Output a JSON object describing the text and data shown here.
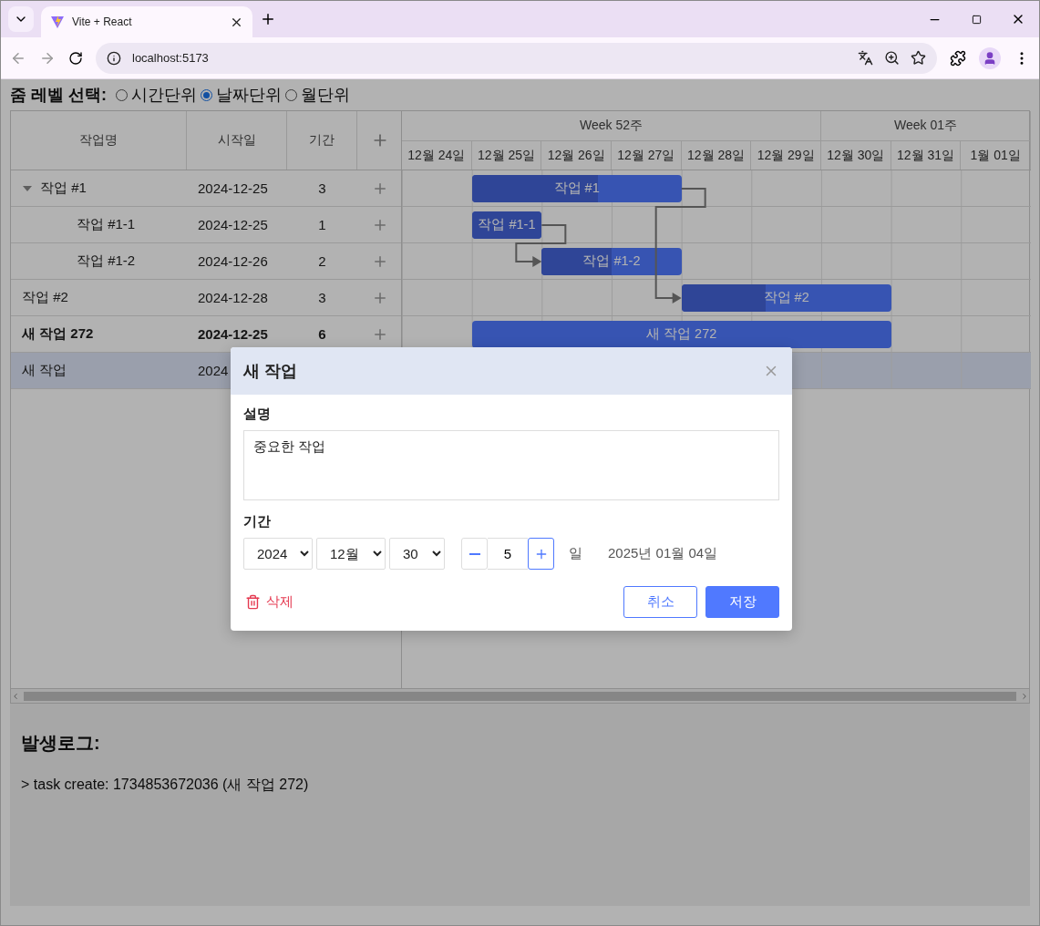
{
  "browser": {
    "tab_title": "Vite + React",
    "url": "localhost:5173"
  },
  "zoom": {
    "label": "줌 레벨 선택:",
    "options": [
      {
        "label": "시간단위",
        "selected": false
      },
      {
        "label": "날짜단위",
        "selected": true
      },
      {
        "label": "월단위",
        "selected": false
      }
    ]
  },
  "gantt": {
    "columns": [
      "작업명",
      "시작일",
      "기간"
    ],
    "weeks": [
      {
        "label": "Week 52주",
        "days": [
          "12월 24일",
          "12월 25일",
          "12월 26일",
          "12월 27일",
          "12월 28일",
          "12월 29일"
        ]
      },
      {
        "label": "Week 01주",
        "days": [
          "12월 30일",
          "12월 31일",
          "1월 01일"
        ]
      }
    ],
    "tasks": [
      {
        "name": "작업 #1",
        "start": "2024-12-25",
        "duration": "3",
        "bold": false,
        "selected": false,
        "expanded": true,
        "bar": {
          "label": "작업 #1",
          "level": 0.6
        },
        "children": [
          {
            "name": "작업 #1-1",
            "start": "2024-12-25",
            "duration": "1",
            "bold": false,
            "selected": false,
            "bar": {
              "label": "작업 #1-1",
              "level": 1
            }
          },
          {
            "name": "작업 #1-2",
            "start": "2024-12-26",
            "duration": "2",
            "bold": false,
            "selected": false,
            "bar": {
              "label": "작업 #1-2",
              "level": 0.5
            }
          }
        ]
      },
      {
        "name": "작업 #2",
        "start": "2024-12-28",
        "duration": "3",
        "bold": false,
        "selected": false,
        "bar": {
          "label": "작업 #2",
          "level": 0.4
        }
      },
      {
        "name": "새 작업 272",
        "start": "2024-12-25",
        "duration": "6",
        "bold": true,
        "selected": false,
        "bar": {
          "label": "새 작업 272"
        }
      },
      {
        "name": "새 작업",
        "start": "2024",
        "bold": false,
        "selected": true
      }
    ]
  },
  "log": {
    "title": "발생로그:",
    "entries": [
      "> task create: 1734853672036 (새 작업 272)"
    ]
  },
  "dialog": {
    "title": "새 작업",
    "description_label": "설명",
    "description": "중요한 작업",
    "duration_label": "기간",
    "year": "2024",
    "month": "12월",
    "day": "30",
    "days": "5",
    "days_unit": "일",
    "end_date": "2025년 01월 04일",
    "delete": "삭제",
    "cancel": "취소",
    "save": "저장"
  }
}
